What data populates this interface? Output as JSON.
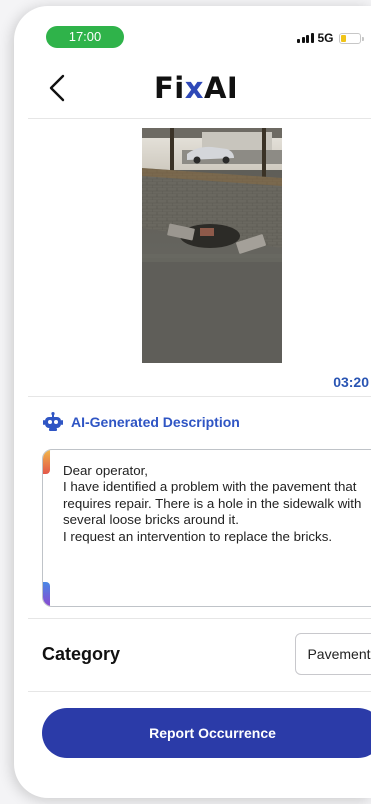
{
  "status_bar": {
    "time": "17:00",
    "network": "5G",
    "time_pill_color": "#2fb34a",
    "battery_level": 0.25,
    "signal_icon": "cellular-signal-icon",
    "battery_icon": "battery-low-icon"
  },
  "header": {
    "back_icon": "chevron-left-icon",
    "logo_prefix": "Fi",
    "logo_x": "x",
    "logo_suffix": "AI",
    "logo_accent_color": "#2f49b8"
  },
  "media": {
    "photo_description_icon": "street-photo",
    "duration": "03:20"
  },
  "ai_section": {
    "icon": "robot-icon",
    "title": "AI-Generated Description",
    "description": "Dear operator,\nI have identified a problem with the pavement that requires repair. There is a hole in the sidewalk with several loose bricks around it.\nI request an intervention to replace the bricks."
  },
  "category": {
    "label": "Category",
    "value": "Pavement"
  },
  "actions": {
    "report_label": "Report Occurrence",
    "report_color": "#2b3ba8"
  }
}
